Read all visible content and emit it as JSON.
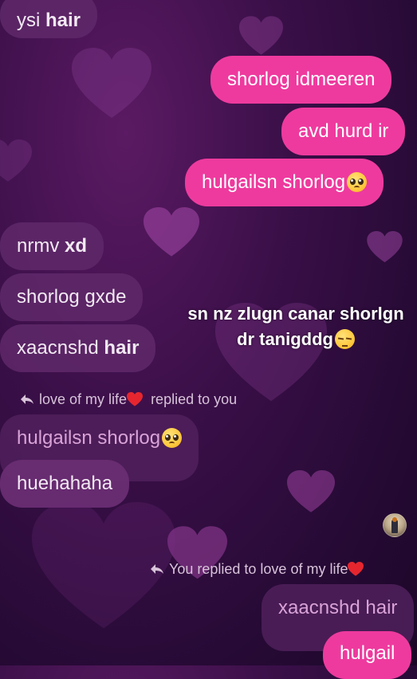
{
  "messages": [
    {
      "id": "m1",
      "side": "in",
      "plain": "ysi ",
      "bold": "hair"
    },
    {
      "id": "m2",
      "side": "out",
      "text": "shorlog idmeeren"
    },
    {
      "id": "m3",
      "side": "out",
      "text": "avd hurd ir"
    },
    {
      "id": "m4",
      "side": "out",
      "text": "hulgailsn shorlog",
      "emoji": "pleading-face"
    },
    {
      "id": "m5",
      "side": "in",
      "plain": "nrmv ",
      "bold": "xd"
    },
    {
      "id": "m6",
      "side": "in",
      "text": "shorlog gxde"
    },
    {
      "id": "m7",
      "side": "in",
      "plain": "xaacnshd ",
      "bold": "hair"
    },
    {
      "id": "m8",
      "side": "in-reply-source",
      "text": "hulgailsn shorlog",
      "emoji": "pleading-face"
    },
    {
      "id": "m9",
      "side": "in",
      "text": "huehahaha"
    },
    {
      "id": "m10",
      "side": "out-reply-source",
      "text": "xaacnshd hair"
    },
    {
      "id": "m11",
      "side": "out",
      "text": "hulgail"
    }
  ],
  "overlay_caption": {
    "line1": "sn nz zlugn canar shorlgn",
    "line2": "dr tanigddg",
    "emoji": "pensive-face"
  },
  "reply_notes": [
    {
      "before": "love of my life",
      "after": "replied to you"
    },
    {
      "before": "You replied to love of my life",
      "after": ""
    }
  ],
  "colors": {
    "outgoing_bubble": "#ee3a9e",
    "incoming_bubble": "#5f2869",
    "background": "#3a0f48"
  }
}
